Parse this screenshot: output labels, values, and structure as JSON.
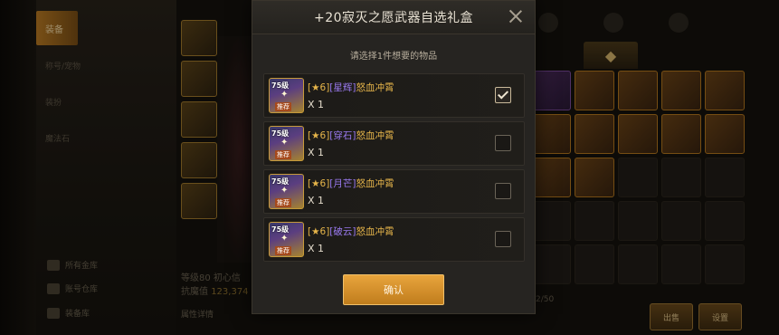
{
  "background": {
    "side_tabs": [
      "装备",
      "称号/宠物",
      "装扮",
      "魔法石"
    ],
    "bottom_nav": [
      "所有金库",
      "账号仓库",
      "装备库"
    ],
    "stats": {
      "level_line": "等级80 初心信",
      "power_label": "抗魔值",
      "power_value": "123,374",
      "attr_label": "属性详情"
    },
    "page_count": "2/50",
    "buttons": {
      "sell": "出售",
      "settings": "设置"
    }
  },
  "modal": {
    "title": "+20寂灭之愿武器自选礼盒",
    "close_icon": "close-icon",
    "subtitle": "请选择1件想要的物品",
    "options": [
      {
        "prefix": "[★6]",
        "gem": "[星辉]",
        "name": "怒血冲霄",
        "qty": "X 1",
        "level_badge": "75级",
        "tag": "推荐",
        "checked": true
      },
      {
        "prefix": "[★6]",
        "gem": "[穿石]",
        "name": "怒血冲霄",
        "qty": "X 1",
        "level_badge": "75级",
        "tag": "推荐",
        "checked": false
      },
      {
        "prefix": "[★6]",
        "gem": "[月芒]",
        "name": "怒血冲霄",
        "qty": "X 1",
        "level_badge": "75级",
        "tag": "推荐",
        "checked": false
      },
      {
        "prefix": "[★6]",
        "gem": "[破云]",
        "name": "怒血冲霄",
        "qty": "X 1",
        "level_badge": "75级",
        "tag": "推荐",
        "checked": false
      }
    ],
    "confirm_label": "确认"
  },
  "colors": {
    "accent": "#e6b54a",
    "confirm": "#d9912c",
    "gem": "#9a7af0"
  }
}
